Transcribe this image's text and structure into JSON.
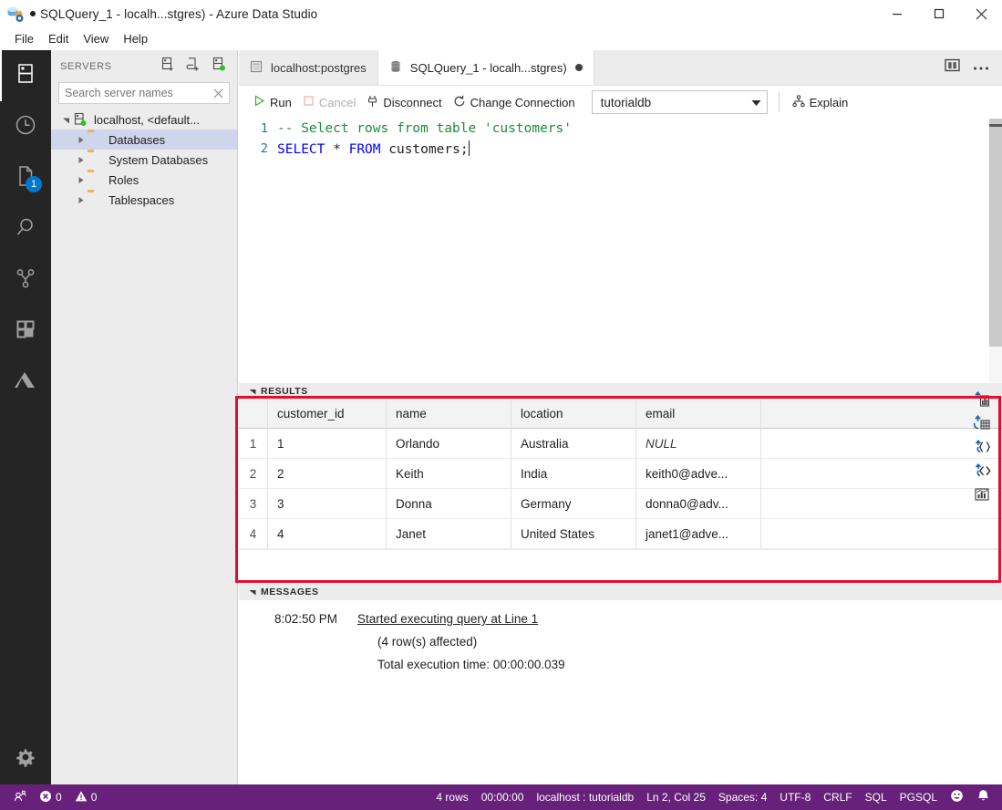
{
  "window": {
    "app_icon": "azure-data-studio-icon",
    "dirty_indicator": "●",
    "title": "SQLQuery_1 - localh...stgres) - Azure Data Studio",
    "controls": {
      "minimize": "minimize-icon",
      "maximize": "maximize-icon",
      "close": "close-icon"
    }
  },
  "menubar": {
    "items": [
      {
        "label": "File"
      },
      {
        "label": "Edit"
      },
      {
        "label": "View"
      },
      {
        "label": "Help"
      }
    ]
  },
  "activitybar": {
    "items": [
      {
        "name": "servers-icon",
        "title": "Servers",
        "active": true,
        "badge": null
      },
      {
        "name": "history-clock-icon",
        "title": "Query History",
        "active": false,
        "badge": null
      },
      {
        "name": "notebooks-file-icon",
        "title": "Notebooks",
        "active": false,
        "badge": "1"
      },
      {
        "name": "search-magnifier-icon",
        "title": "Search",
        "active": false,
        "badge": null
      },
      {
        "name": "source-control-branch-icon",
        "title": "Source Control",
        "active": false,
        "badge": null
      },
      {
        "name": "extensions-icon",
        "title": "Extensions",
        "active": false,
        "badge": null
      },
      {
        "name": "azure-triangle-icon",
        "title": "Azure",
        "active": false,
        "badge": null
      }
    ],
    "bottom": {
      "name": "settings-gear-icon",
      "title": "Manage"
    }
  },
  "sidebar": {
    "title": "SERVERS",
    "actions": [
      {
        "name": "new-connection-icon",
        "title": "New Connection"
      },
      {
        "name": "new-server-group-icon",
        "title": "New Server Group"
      },
      {
        "name": "refresh-servers-icon",
        "title": "Refresh"
      }
    ],
    "search": {
      "placeholder": "Search server names",
      "value": "",
      "clear_icon": "close-icon"
    },
    "tree": [
      {
        "label": "localhost, <default...",
        "icon": "server-connected-icon",
        "level": 0,
        "expanded": true,
        "selected": false
      },
      {
        "label": "Databases",
        "icon": "folder-icon",
        "level": 1,
        "expanded": false,
        "selected": true
      },
      {
        "label": "System Databases",
        "icon": "folder-icon",
        "level": 1,
        "expanded": false,
        "selected": false
      },
      {
        "label": "Roles",
        "icon": "folder-icon",
        "level": 1,
        "expanded": false,
        "selected": false
      },
      {
        "label": "Tablespaces",
        "icon": "folder-icon",
        "level": 1,
        "expanded": false,
        "selected": false
      }
    ]
  },
  "tabs": {
    "items": [
      {
        "label": "localhost:postgres",
        "icon": "dashboard-icon",
        "active": false,
        "dirty": false
      },
      {
        "label": "SQLQuery_1 - localh...stgres)",
        "icon": "query-file-icon",
        "active": true,
        "dirty": true
      }
    ],
    "actions": [
      {
        "name": "split-editor-icon",
        "title": "Split Editor"
      },
      {
        "name": "more-actions-icon",
        "title": "More Actions..."
      }
    ]
  },
  "query_toolbar": {
    "run": {
      "label": "Run",
      "icon": "play-triangle-icon",
      "enabled": true
    },
    "cancel": {
      "label": "Cancel",
      "icon": "stop-square-icon",
      "enabled": false
    },
    "disconnect": {
      "label": "Disconnect",
      "icon": "disconnect-plug-icon",
      "enabled": true
    },
    "change_connection": {
      "label": "Change Connection",
      "icon": "change-connection-icon",
      "enabled": true
    },
    "database_select": {
      "value": "tutorialdb",
      "chevron": "chevron-down-icon"
    },
    "explain": {
      "label": "Explain",
      "icon": "explain-plan-icon",
      "enabled": true
    }
  },
  "editor": {
    "lines": [
      {
        "number": "1",
        "comment": "-- Select rows from table 'customers'"
      },
      {
        "number": "2",
        "kw1": "SELECT",
        "star": " * ",
        "kw2": "FROM",
        "rest": " customers;"
      }
    ]
  },
  "results": {
    "header": "RESULTS",
    "columns": [
      "customer_id",
      "name",
      "location",
      "email"
    ],
    "rows": [
      {
        "num": "1",
        "customer_id": "1",
        "name": "Orlando",
        "location": "Australia",
        "email": "NULL",
        "email_is_null": true
      },
      {
        "num": "2",
        "customer_id": "2",
        "name": "Keith",
        "location": "India",
        "email": "keith0@adve...",
        "email_is_null": false
      },
      {
        "num": "3",
        "customer_id": "3",
        "name": "Donna",
        "location": "Germany",
        "email": "donna0@adv...",
        "email_is_null": false
      },
      {
        "num": "4",
        "customer_id": "4",
        "name": "Janet",
        "location": "United States",
        "email": "janet1@adve...",
        "email_is_null": false
      }
    ],
    "actions": [
      {
        "name": "save-as-excel-icon",
        "title": "Save As Excel"
      },
      {
        "name": "save-as-csv-icon",
        "title": "Save As CSV"
      },
      {
        "name": "save-as-json-icon",
        "title": "Save As JSON"
      },
      {
        "name": "save-as-xml-icon",
        "title": "Save As XML"
      },
      {
        "name": "view-as-chart-icon",
        "title": "View as Chart"
      }
    ],
    "highlight_color": "#ec0a2a"
  },
  "messages": {
    "header": "MESSAGES",
    "timestamp": "8:02:50 PM",
    "link": "Started executing query at Line 1",
    "lines": [
      "(4 row(s) affected)",
      "Total execution time: 00:00:00.039"
    ]
  },
  "statusbar": {
    "background": "#68217a",
    "left": [
      {
        "name": "remote-connect-icon",
        "label": ""
      },
      {
        "name": "error-icon",
        "label": "0"
      },
      {
        "name": "warning-icon",
        "label": "0"
      }
    ],
    "right": [
      {
        "name": "row-count",
        "label": "4 rows"
      },
      {
        "name": "execution-time",
        "label": "00:00:00"
      },
      {
        "name": "connection-info",
        "label": "localhost : tutorialdb"
      },
      {
        "name": "cursor-position",
        "label": "Ln 2, Col 25"
      },
      {
        "name": "indentation",
        "label": "Spaces: 4"
      },
      {
        "name": "encoding",
        "label": "UTF-8"
      },
      {
        "name": "line-endings",
        "label": "CRLF"
      },
      {
        "name": "language-mode",
        "label": "SQL"
      },
      {
        "name": "provider",
        "label": "PGSQL"
      },
      {
        "name": "feedback-smiley-icon",
        "label": ""
      },
      {
        "name": "notifications-bell-icon",
        "label": ""
      }
    ]
  }
}
